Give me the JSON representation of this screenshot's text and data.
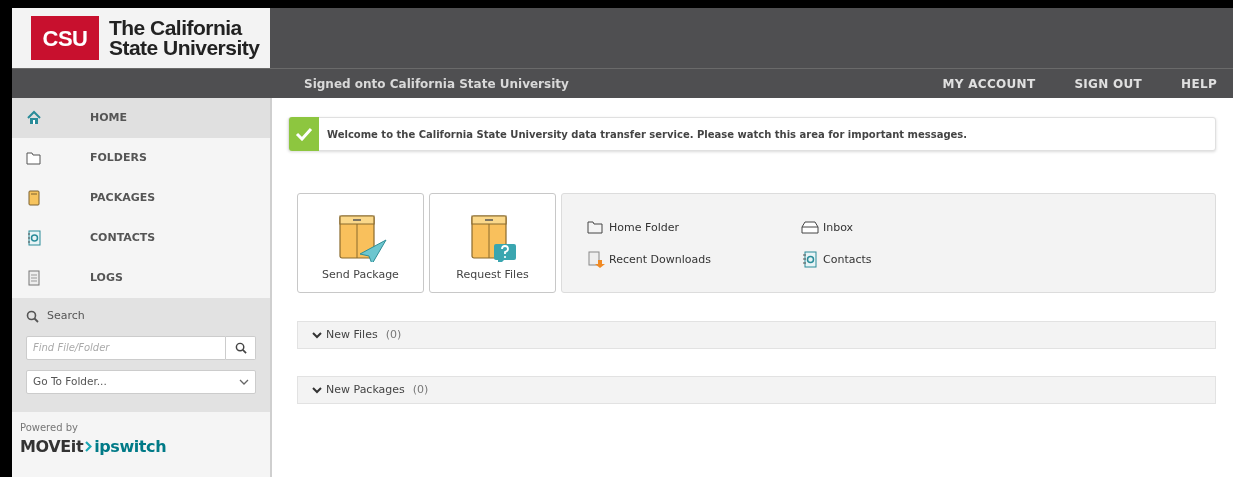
{
  "header": {
    "logo": {
      "mark": "CSU",
      "name_lines": [
        "The California",
        "State University"
      ]
    },
    "signed_on": "Signed onto **California State University**",
    "nav_links": [
      "MY ACCOUNT",
      "SIGN OUT",
      "HELP"
    ]
  },
  "sidebar": {
    "items": [
      {
        "label": "HOME",
        "kind": "home",
        "selected": true
      },
      {
        "label": "FOLDERS",
        "kind": "folder",
        "selected": false
      },
      {
        "label": "PACKAGES",
        "kind": "package",
        "selected": false
      },
      {
        "label": "CONTACTS",
        "kind": "contacts",
        "selected": false
      },
      {
        "label": "LOGS",
        "kind": "logs",
        "selected": false
      }
    ],
    "search": {
      "title": "Search",
      "placeholder": "Find File/Folder",
      "folder_select": "Go To Folder..."
    },
    "powered_by": {
      "caption": "Powered by",
      "brand": "MOVEit",
      "vendor": "ipswitch"
    }
  },
  "message": "Welcome to the California State University data transfer service. Please watch this area for important messages.",
  "actions": [
    {
      "label": "Send Package",
      "kind": "send"
    },
    {
      "label": "Request Files",
      "kind": "request"
    }
  ],
  "quick_links": [
    {
      "label": "Home Folder",
      "kind": "folder"
    },
    {
      "label": "Inbox",
      "kind": "inbox"
    },
    {
      "label": "Recent Downloads",
      "kind": "downloads"
    },
    {
      "label": "Contacts",
      "kind": "contacts"
    }
  ],
  "sections": [
    {
      "title": "New Files",
      "count": "(0)",
      "expanded": true
    },
    {
      "title": "New Packages",
      "count": "(0)",
      "expanded": true
    }
  ]
}
